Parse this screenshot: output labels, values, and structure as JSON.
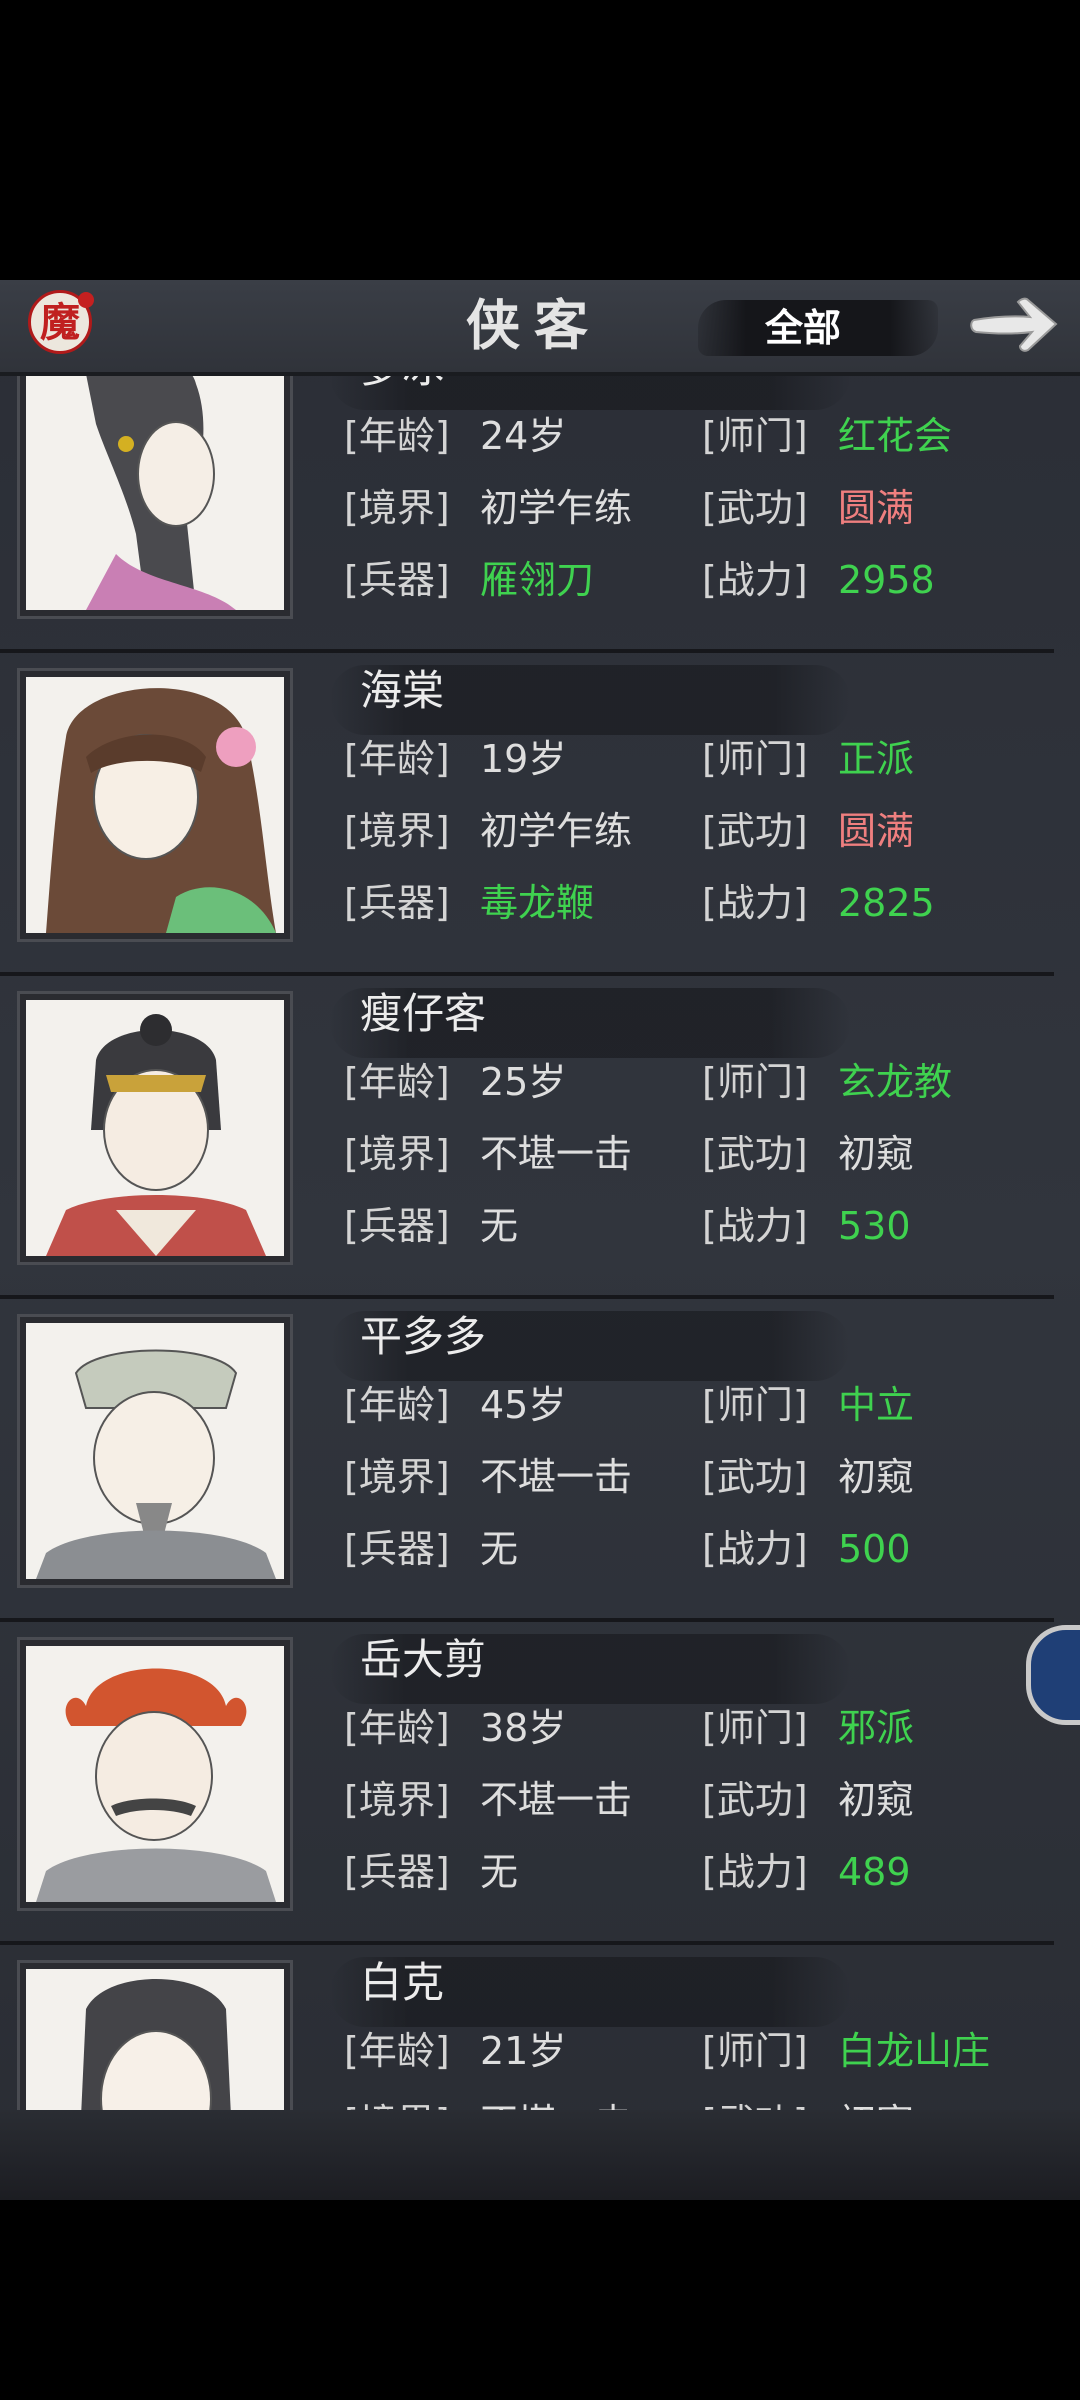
{
  "header": {
    "title": "侠客",
    "logo_char": "魔",
    "filter_label": "全部"
  },
  "labels": {
    "age": "[年龄]",
    "sect": "[师门]",
    "realm": "[境界]",
    "kungfu": "[武功]",
    "weapon": "[兵器]",
    "power": "[战力]"
  },
  "heroes": [
    {
      "name": "萝冰",
      "age": "24岁",
      "sect": "红花会",
      "realm": "初学乍练",
      "kungfu": "圆满",
      "weapon": "雁翎刀",
      "power": "2958"
    },
    {
      "name": "海棠",
      "age": "19岁",
      "sect": "正派",
      "realm": "初学乍练",
      "kungfu": "圆满",
      "weapon": "毒龙鞭",
      "power": "2825"
    },
    {
      "name": "瘦仔客",
      "age": "25岁",
      "sect": "玄龙教",
      "realm": "不堪一击",
      "kungfu": "初窥",
      "weapon": "无",
      "power": "530"
    },
    {
      "name": "平多多",
      "age": "45岁",
      "sect": "中立",
      "realm": "不堪一击",
      "kungfu": "初窥",
      "weapon": "无",
      "power": "500"
    },
    {
      "name": "岳大剪",
      "age": "38岁",
      "sect": "邪派",
      "realm": "不堪一击",
      "kungfu": "初窥",
      "weapon": "无",
      "power": "489"
    },
    {
      "name": "白克",
      "age": "21岁",
      "sect": "白龙山庄",
      "realm": "不堪一击",
      "kungfu": "初窥",
      "weapon": "",
      "power": ""
    }
  ],
  "colors": {
    "highlight_green": "#3fd24f",
    "highlight_pink": "#ef7f7f",
    "logo_red": "#c02020"
  }
}
